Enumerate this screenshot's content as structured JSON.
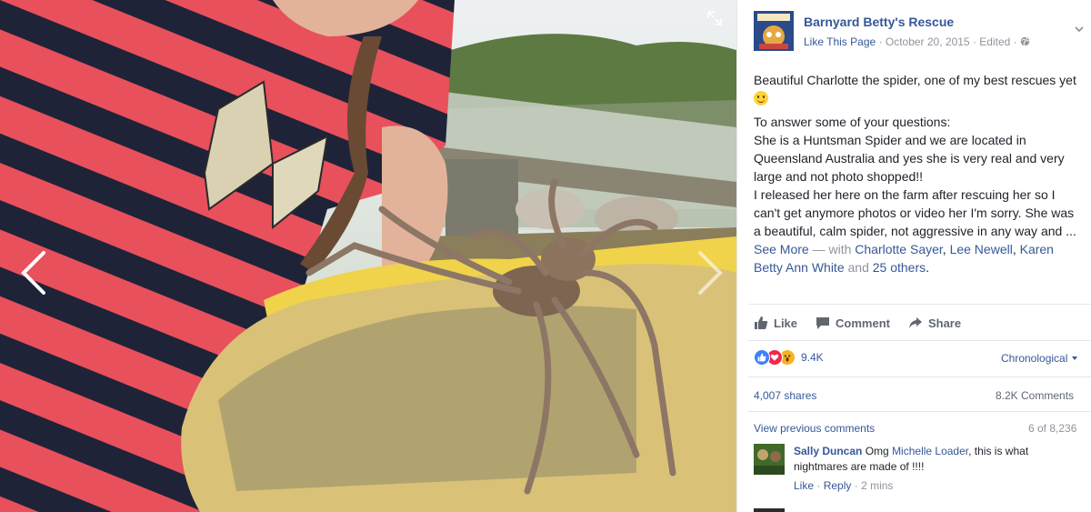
{
  "post": {
    "page_name": "Barnyard Betty's Rescue",
    "avatar_text": "BARNYARD BETTY'S",
    "like_page": "Like This Page",
    "date": "October 20, 2015",
    "edited": "Edited",
    "sep": "·",
    "text_line1": "Beautiful Charlotte the spider, one of my best rescues yet",
    "text_para2": "To answer some of your questions:",
    "text_para3": "She is a Huntsman Spider and we are located in Queensland Australia and yes she is very real and very large and not photo shopped!!",
    "text_para4": "I released her here on the farm after rescuing her so I can't get anymore photos or video her I'm sorry. She was a beautiful, calm spider, not aggressive in any way and ...",
    "see_more": "See More",
    "with_text": "— with",
    "tag1": "Charlotte Sayer",
    "comma": ",",
    "tag2": "Lee Newell",
    "tag3": "Karen Betty Ann White",
    "and_text": "and",
    "others": "25 others",
    "period": "."
  },
  "actions": {
    "like": "Like",
    "comment": "Comment",
    "share": "Share"
  },
  "stats": {
    "reactions_count": "9.4K",
    "order": "Chronological",
    "shares": "4,007 shares",
    "comments": "8.2K Comments"
  },
  "comments": {
    "view_previous": "View previous comments",
    "count_shown": "6 of 8,236",
    "items": [
      {
        "author": "Sally Duncan",
        "pre": "Omg",
        "mention": "Michelle Loader",
        "text": ", this is what nightmares are made of !!!!",
        "like": "Like",
        "reply": "Reply",
        "time": "2 mins",
        "dot": "·"
      }
    ]
  },
  "icons": {
    "prev": "chevron-left-icon",
    "next": "chevron-right-icon",
    "expand": "expand-icon",
    "globe": "globe-icon",
    "menu": "chevron-down-icon",
    "like": "thumbs-up-icon",
    "comment": "speech-bubble-icon",
    "share": "share-arrow-icon",
    "reactions": [
      "like-reaction-icon",
      "love-reaction-icon",
      "wow-reaction-icon"
    ]
  },
  "colors": {
    "link": "#365899",
    "muted": "#90949c",
    "like_reaction": "#4080ff",
    "love_reaction": "#f0284a",
    "wow_reaction": "#f7b125"
  }
}
